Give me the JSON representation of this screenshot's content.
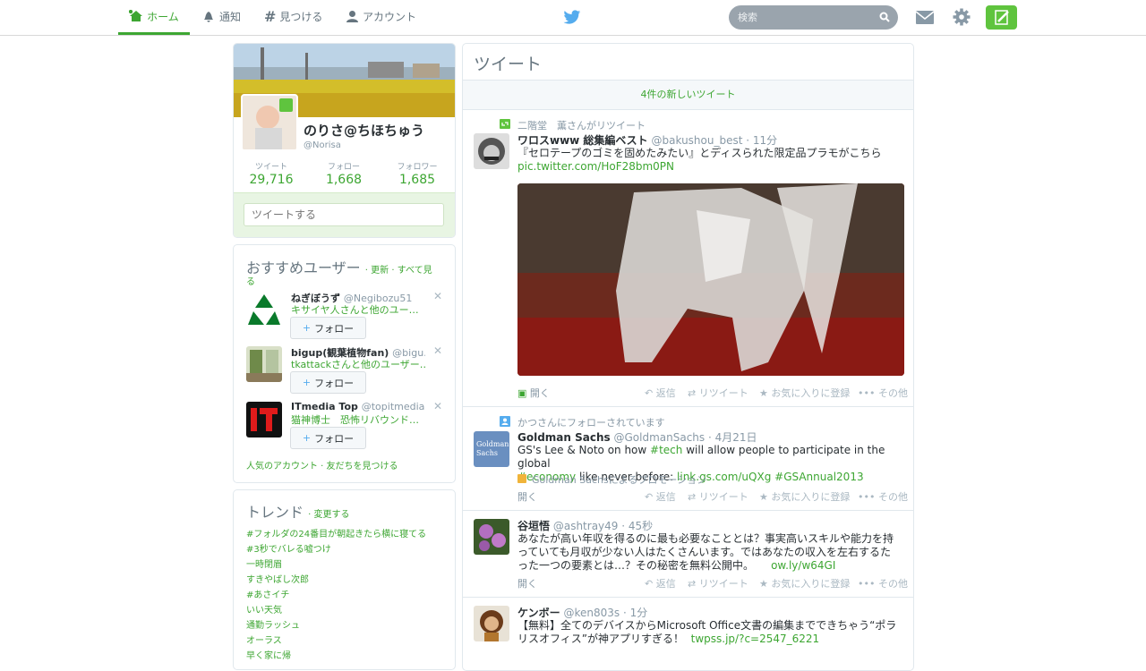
{
  "nav": {
    "home": "ホーム",
    "notifications": "通知",
    "discover": "見つける",
    "account": "アカウント",
    "search_placeholder": "検索"
  },
  "colors": {
    "accent": "#3da632",
    "compose": "#5fc43e"
  },
  "profile": {
    "name": "のりさ@ちほちゅう",
    "handle": "@Norisa",
    "stats": [
      {
        "label": "ツイート",
        "value": "29,716"
      },
      {
        "label": "フォロー",
        "value": "1,668"
      },
      {
        "label": "フォロワー",
        "value": "1,685"
      }
    ],
    "tweet_placeholder": "ツイートする"
  },
  "wtf": {
    "title": "おすすめユーザー",
    "links_line1": "· 更新 · すべて見",
    "links_line2": "る",
    "users": [
      {
        "name": "ねぎぼうず",
        "handle": "@Negibozu51",
        "context": "キサイヤ人さんと他のユー…",
        "follow": "フォロー"
      },
      {
        "name": "bigup(観葉植物fan)",
        "handle": "@bigu…",
        "context": "tkattackさんと他のユーザー…",
        "follow": "フォロー"
      },
      {
        "name": "ITmedia Top",
        "handle": "@topitmedia",
        "context": "猫神博士　恐怖リバウンド…",
        "follow": "フォロー"
      }
    ],
    "footer": "人気のアカウント · 友だちを見つける"
  },
  "trends": {
    "title": "トレンド",
    "change": "· 変更する",
    "items": [
      "#フォルダの24番目が朝起きたら横に寝てる",
      "#3秒でバレる嘘つけ",
      "一時閉眉",
      "すきやばし次郎",
      "#あさイチ",
      "いい天気",
      "通勤ラッシュ",
      "オーラス",
      "早く家に帰"
    ]
  },
  "stream": {
    "title": "ツイート",
    "new_tweets": "4件の新しいツイート",
    "tweets": [
      {
        "context": "二階堂　薫さんがリツイート",
        "name": "ワロスwww 総集編ベスト",
        "handle": "@bakushou_best",
        "time": "· 11分",
        "text": "『セロテープのゴミを固めたみたい』とディスられた限定品プラモがこちら",
        "link": "pic.twitter.com/HoF28bm0PN",
        "open": "開く",
        "reply": "返信",
        "retweet": "リツイート",
        "favorite": "お気に入りに登録",
        "more": "その他"
      },
      {
        "context": "かつさんにフォローされています",
        "name": "Goldman Sachs",
        "handle": "@GoldmanSachs",
        "time": "· 4月21日",
        "text_a": "GS's Lee & Noto on how ",
        "hash1": "#tech",
        "text_b": " will allow people to participate in the global",
        "hash2": "#economy",
        "text_c": " like never before: ",
        "link": "link.gs.com/uQXg",
        "hash3": "#GSAnnual2013",
        "promo": "Goldman Sachsによるプロモーション",
        "open": "開く",
        "reply": "返信",
        "retweet": "リツイート",
        "favorite": "お気に入りに登録",
        "more": "その他"
      },
      {
        "name": "谷垣悟",
        "handle": "@ashtray49",
        "time": "· 45秒",
        "line1": "あなたが高い年収を得るのに最も必要なこととは？事実高いスキルや能力を持",
        "line2": "っていても月収が少ない人はたくさんいます。ではあなたの収入を左右するた",
        "line3": "った一つの要素とは…？その秘密を無料公開中。",
        "link": "ow.ly/w64GI",
        "open": "開く",
        "reply": "返信",
        "retweet": "リツイート",
        "favorite": "お気に入りに登録",
        "more": "その他"
      },
      {
        "name": "ケンボー",
        "handle": "@ken803s",
        "time": "· 1分",
        "line1": "【無料】全てのデバイスからMicrosoft Office文書の編集までできちゃう“ポラ",
        "line2": "リスオフィス”が神アプリすぎる！",
        "link": "twpss.jp/?c=2547_6221"
      }
    ]
  }
}
